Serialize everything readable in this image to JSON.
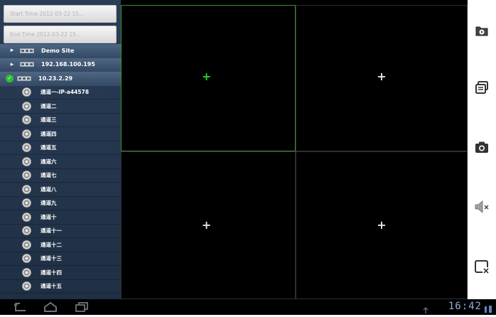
{
  "time_fields": {
    "start_placeholder": "Start Time 2012-03-22 15...",
    "end_placeholder": "End Time 2012-03-22 15..."
  },
  "tree": {
    "sites": [
      {
        "label": "Demo Site",
        "expanded": false
      },
      {
        "label": "192.168.100.195",
        "expanded": false
      },
      {
        "label": "10.23.2.29",
        "expanded": true
      }
    ],
    "channels": [
      "通道一-IP-a44578",
      "通道二",
      "通道三",
      "通道四",
      "通道五",
      "通道六",
      "通道七",
      "通道八",
      "通道九",
      "通道十",
      "通道十一",
      "通道十二",
      "通道十三",
      "通道十四",
      "通道十五"
    ]
  },
  "video_grid": {
    "selected_pane": 1,
    "panes": [
      {
        "id": 1,
        "symbol": "+"
      },
      {
        "id": 2,
        "symbol": "+"
      },
      {
        "id": 3,
        "symbol": "+"
      },
      {
        "id": 4,
        "symbol": "+"
      }
    ]
  },
  "toolbar": {
    "icons": [
      "playback-icon",
      "switch-view-icon",
      "snapshot-camera-icon",
      "mute-icon",
      "close-window-icon"
    ]
  },
  "status_bar": {
    "clock": "16:42"
  },
  "colors": {
    "selection_green": "#2bd12b",
    "sidebar_bg": "#22344b",
    "clock_color": "#8fb0d4"
  }
}
